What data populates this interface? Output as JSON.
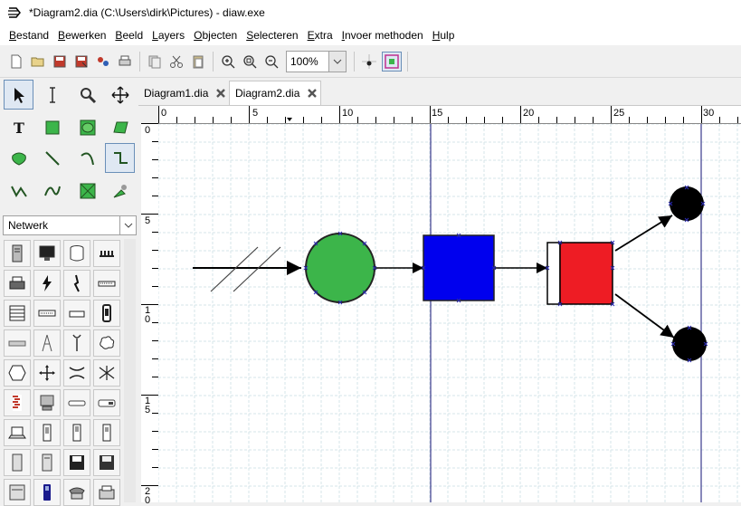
{
  "window": {
    "title": "*Diagram2.dia (C:\\Users\\dirk\\Pictures) - diaw.exe"
  },
  "menu": [
    {
      "u": "B",
      "rest": "estand"
    },
    {
      "u": "B",
      "rest": "ewerken"
    },
    {
      "u": "B",
      "rest": "eeld"
    },
    {
      "u": "L",
      "rest": "ayers"
    },
    {
      "u": "O",
      "rest": "bjecten"
    },
    {
      "u": "S",
      "rest": "electeren"
    },
    {
      "u": "E",
      "rest": "xtra"
    },
    {
      "u": "I",
      "rest": "nvoer methoden"
    },
    {
      "u": "H",
      "rest": "ulp"
    }
  ],
  "toolbar": {
    "zoom_value": "100%"
  },
  "sheet": {
    "selected": "Netwerk"
  },
  "tabs": [
    {
      "label": "Diagram1.dia"
    },
    {
      "label": "Diagram2.dia"
    }
  ],
  "rulers": {
    "h_labels": [
      "0",
      "5",
      "10",
      "15",
      "20",
      "25",
      "30"
    ],
    "v_labels": [
      "0",
      "5",
      "10",
      "15",
      "20"
    ]
  },
  "colors": {
    "circle": "#3cb54a",
    "square": "#0000ee",
    "red_box": "#ee1c24",
    "guide": "#3a3a8c",
    "selection": "#2b2bb0"
  }
}
